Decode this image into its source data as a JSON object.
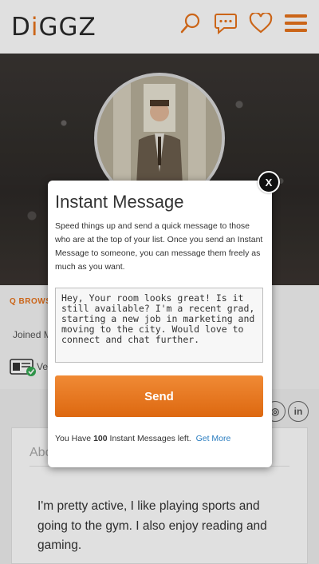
{
  "header": {
    "logo": "DiGGZ",
    "icons": [
      "search-icon",
      "chat-icon",
      "heart-icon",
      "menu-icon"
    ],
    "accent": "#e8731c"
  },
  "background": {
    "browse_label": "Q BROWS",
    "joined_label": "Joined M",
    "verified_label": "Ve",
    "about_title": "Abo",
    "about_text": "I'm pretty active, I like playing sports and going to the gym. I also enjoy reading and gaming."
  },
  "modal": {
    "title": "Instant Message",
    "description": "Speed things up and send a quick message to those who are at the top of your list. Once you send an Instant Message to someone, you can message them freely as much as you want.",
    "message_value": "Hey, Your room looks great! Is it still available? I'm a recent grad, starting a new job in marketing and moving to the city. Would love to connect and chat further.",
    "send_label": "Send",
    "remaining_prefix": "You Have",
    "remaining_count": "100",
    "remaining_suffix": "Instant Messages left.",
    "get_more_label": "Get More",
    "close_label": "X"
  }
}
